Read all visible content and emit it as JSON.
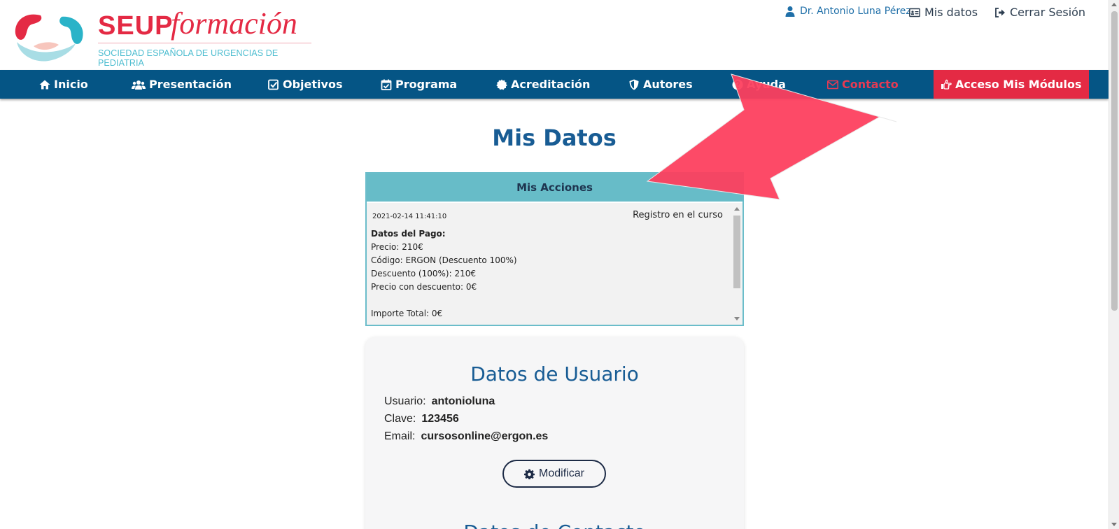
{
  "brand": {
    "name_main": "SEUP",
    "name_script": "formación",
    "subtitle": "SOCIEDAD ESPAÑOLA DE URGENCIAS DE PEDIATRIA",
    "primary_color": "#e42a44",
    "accent_color": "#4dbdd0"
  },
  "topbar": {
    "user_name": "Dr. Antonio Luna Pérez",
    "my_data": "Mis datos",
    "logout": "Cerrar Sesión"
  },
  "nav": {
    "color": "#055585",
    "items": [
      {
        "label": "Inicio",
        "icon": "home-icon"
      },
      {
        "label": "Presentación",
        "icon": "users-icon"
      },
      {
        "label": "Objetivos",
        "icon": "check-square-icon"
      },
      {
        "label": "Programa",
        "icon": "calendar-check-icon"
      },
      {
        "label": "Acreditación",
        "icon": "certificate-icon"
      },
      {
        "label": "Autores",
        "icon": "shield-icon"
      },
      {
        "label": "Ayuda",
        "icon": "question-circle-icon"
      },
      {
        "label": "Contacto",
        "icon": "envelope-icon"
      },
      {
        "label": "Acceso Mis Módulos",
        "icon": "hand-point-right-icon"
      }
    ]
  },
  "page": {
    "title": "Mis Datos"
  },
  "acciones": {
    "header": "Mis Acciones",
    "entries": [
      {
        "date": "2021-02-14 11:41:10",
        "event": "Registro en el curso",
        "details_title": "Datos del Pago:",
        "lines": [
          "Precio: 210€",
          "Código: ERGON (Descuento 100%)",
          "Descuento (100%): 210€",
          "Precio con descuento: 0€"
        ],
        "total": "Importe Total: 0€"
      }
    ]
  },
  "usuario": {
    "title": "Datos de Usuario",
    "fields": [
      {
        "label": "Usuario:",
        "value": "antonioluna"
      },
      {
        "label": "Clave:",
        "value": "123456"
      },
      {
        "label": "Email:",
        "value": "cursosonline@ergon.es"
      }
    ],
    "modify_button": "Modificar",
    "next_section_title": "Datos de Contacto"
  }
}
